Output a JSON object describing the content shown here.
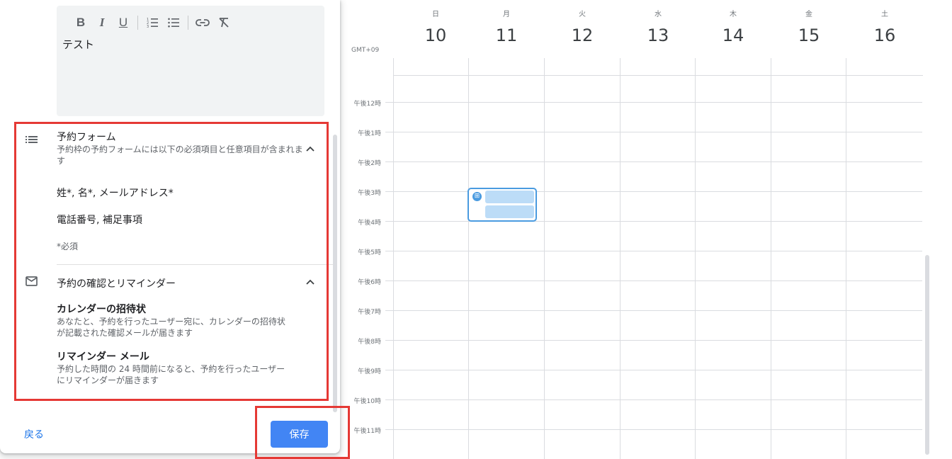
{
  "editor": {
    "toolbar": [
      {
        "name": "bold-button",
        "glyph": "B"
      },
      {
        "name": "italic-button",
        "glyph": "I"
      },
      {
        "name": "underline-button",
        "glyph": "U"
      }
    ],
    "text": "テスト"
  },
  "booking_form": {
    "title": "予約フォーム",
    "description": "予約枠の予約フォームには以下の必須項目と任意項目が含まれます",
    "required_fields": "姓*, 名*, メールアドレス*",
    "optional_fields": "電話番号, 補足事項",
    "required_note": "*必須"
  },
  "confirmation": {
    "title": "予約の確認とリマインダー",
    "invite_title": "カレンダーの招待状",
    "invite_desc_1": "あなたと、予約を行ったユーザー宛に、カレンダーの招待状",
    "invite_desc_2": "が記載された確認メールが届きます",
    "reminder_title": "リマインダー メール",
    "reminder_desc_1": "予約した時間の 24 時間前になると、予約を行ったユーザー",
    "reminder_desc_2": "にリマインダーが届きます"
  },
  "footer": {
    "back_label": "戻る",
    "save_label": "保存"
  },
  "calendar": {
    "timezone": "GMT+09",
    "days": [
      {
        "dow": "日",
        "num": "10"
      },
      {
        "dow": "月",
        "num": "11"
      },
      {
        "dow": "火",
        "num": "12"
      },
      {
        "dow": "水",
        "num": "13"
      },
      {
        "dow": "木",
        "num": "14"
      },
      {
        "dow": "金",
        "num": "15"
      },
      {
        "dow": "土",
        "num": "16"
      }
    ],
    "times": [
      "午後12時",
      "午後1時",
      "午後2時",
      "午後3時",
      "午後4時",
      "午後5時",
      "午後6時",
      "午後7時",
      "午後8時",
      "午後9時",
      "午後10時",
      "午後11時"
    ],
    "event_icon": "appointment-grid-icon"
  },
  "colors": {
    "accent": "#4285f4",
    "highlight": "#e53935",
    "event_border": "#4a9be0",
    "event_fill": "#bcdcf7"
  }
}
